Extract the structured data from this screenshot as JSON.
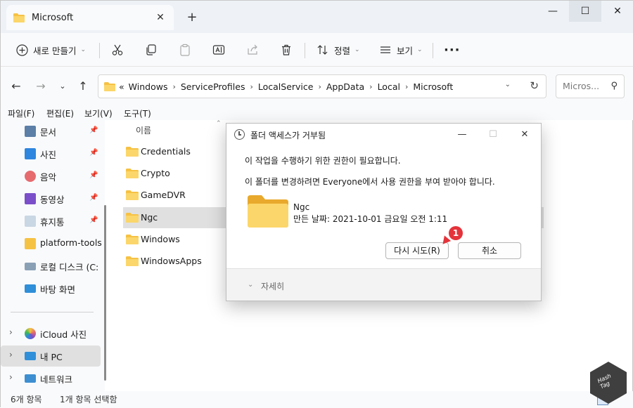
{
  "colors": {
    "accent": "#0067c0",
    "folder": "#f6c244",
    "badge": "#e5333b",
    "selection": "#e0e0e0"
  },
  "tab": {
    "title": "Microsoft",
    "close": "✕",
    "new_tab": "+"
  },
  "window_controls": {
    "minimize": "—",
    "maximize": "☐",
    "close": "✕"
  },
  "toolbar": {
    "new_label": "새로 만들기",
    "sort_label": "정렬",
    "view_label": "보기",
    "more": "···"
  },
  "address": {
    "overflow": "«",
    "crumbs": [
      "Windows",
      "ServiceProfiles",
      "LocalService",
      "AppData",
      "Local",
      "Microsoft"
    ],
    "crumb_sep": "›"
  },
  "search": {
    "placeholder": "Micros..."
  },
  "menubar": [
    "파일(F)",
    "편집(E)",
    "보기(V)",
    "도구(T)"
  ],
  "sidebar": {
    "items": [
      {
        "label": "문서",
        "icon": "documents-icon",
        "pinned": true
      },
      {
        "label": "사진",
        "icon": "pictures-icon",
        "pinned": true
      },
      {
        "label": "음악",
        "icon": "music-icon",
        "pinned": true
      },
      {
        "label": "동영상",
        "icon": "videos-icon",
        "pinned": true
      },
      {
        "label": "휴지통",
        "icon": "recycle-bin-icon",
        "pinned": true
      },
      {
        "label": "platform-tools",
        "icon": "folder-icon",
        "pinned": false
      },
      {
        "label": "로컬 디스크 (C:",
        "icon": "drive-icon",
        "pinned": false
      },
      {
        "label": "바탕 화면",
        "icon": "desktop-icon",
        "pinned": false
      },
      {
        "label": "iCloud 사진",
        "icon": "icloud-photos-icon",
        "pinned": false
      },
      {
        "label": "내 PC",
        "icon": "pc-icon",
        "pinned": false
      },
      {
        "label": "네트워크",
        "icon": "network-icon",
        "pinned": false
      }
    ]
  },
  "filelist": {
    "column_name": "이름",
    "files": [
      "Credentials",
      "Crypto",
      "GameDVR",
      "Ngc",
      "Windows",
      "WindowsApps"
    ],
    "selected": "Ngc"
  },
  "statusbar": {
    "count": "6개 항목",
    "selection": "1개 항목 선택함"
  },
  "logo": {
    "line1": "Hash",
    "line2": "Tag"
  },
  "dialog": {
    "title": "폴더 액세스가 거부됨",
    "message1": "이 작업을 수행하기 위한 권한이 필요합니다.",
    "message2": "이 폴더를 변경하려면 Everyone에서 사용 권한을 부여 받아야 합니다.",
    "folder_name": "Ngc",
    "folder_date": "만든 날짜: 2021-10-01 금요일 오전 1:11",
    "retry_label": "다시 시도(R)",
    "cancel_label": "취소",
    "details_label": "자세히",
    "badge": "1"
  }
}
